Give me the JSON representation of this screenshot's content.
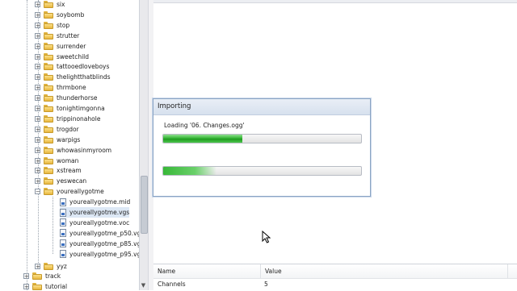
{
  "tree": {
    "folders_top": [
      "six",
      "soybomb",
      "stop",
      "strutter",
      "surrender",
      "sweetchild",
      "tattooedloveboys",
      "thelightthatblinds",
      "thrmbone",
      "thunderhorse",
      "tonightimgonna",
      "trippinonahole",
      "trogdor",
      "warpigs",
      "whowasinmyroom",
      "woman",
      "xstream",
      "yeswecan"
    ],
    "open_folder": "youreallygotme",
    "files": [
      "youreallygotme.mid",
      "youreallygotme.vgs",
      "youreallygotme.voc",
      "youreallygotme_p50.vgs",
      "youreallygotme_p85.vgs",
      "youreallygotme_p95.vgs"
    ],
    "folders_bottom": [
      "yyz"
    ],
    "root_folders": [
      "track",
      "tutorial"
    ]
  },
  "dialog": {
    "title": "Importing",
    "status": "Loading '06. Changes.ogg'",
    "progress1": 0.4,
    "progress2": 0.27
  },
  "properties": {
    "col_name": "Name",
    "col_value": "Value",
    "rows": [
      {
        "name": "Channels",
        "value": "5"
      }
    ]
  }
}
